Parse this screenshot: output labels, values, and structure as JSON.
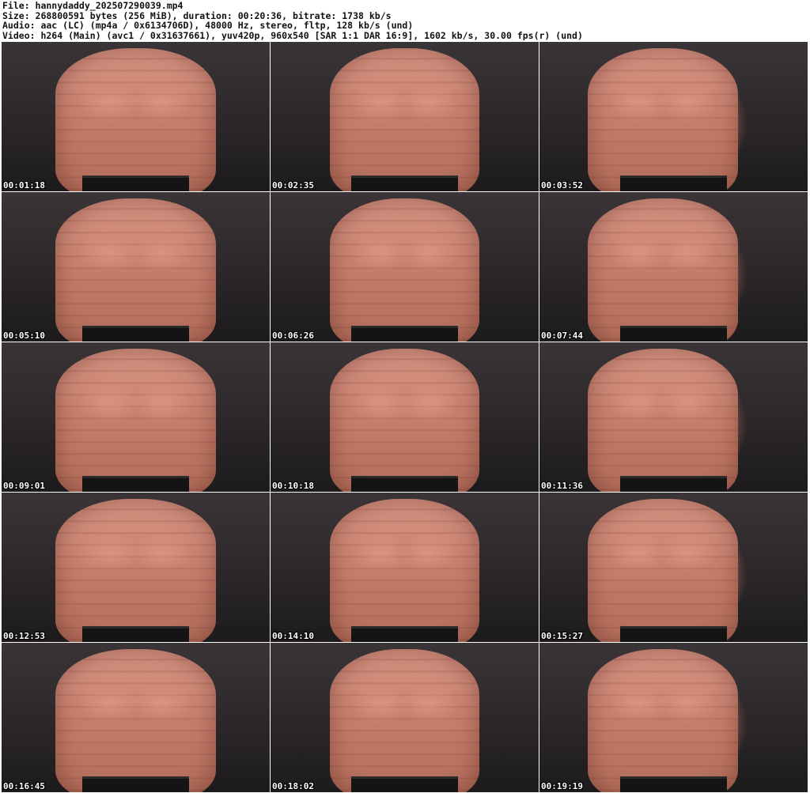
{
  "header": {
    "file": "File: hannydaddy_202507290039.mp4",
    "size": "Size: 268800591 bytes (256 MiB), duration: 00:20:36, bitrate: 1738 kb/s",
    "audio": "Audio: aac (LC) (mp4a / 0x6134706D), 48000 Hz, stereo, fltp, 128 kb/s (und)",
    "video": "Video: h264 (Main) (avc1 / 0x31637661), yuv420p, 960x540 [SAR 1:1 DAR 16:9], 1602 kb/s, 30.00 fps(r) (und)"
  },
  "thumbnails": [
    {
      "timestamp": "00:01:18"
    },
    {
      "timestamp": "00:02:35"
    },
    {
      "timestamp": "00:03:52"
    },
    {
      "timestamp": "00:05:10"
    },
    {
      "timestamp": "00:06:26"
    },
    {
      "timestamp": "00:07:44"
    },
    {
      "timestamp": "00:09:01"
    },
    {
      "timestamp": "00:10:18"
    },
    {
      "timestamp": "00:11:36"
    },
    {
      "timestamp": "00:12:53"
    },
    {
      "timestamp": "00:14:10"
    },
    {
      "timestamp": "00:15:27"
    },
    {
      "timestamp": "00:16:45"
    },
    {
      "timestamp": "00:18:02"
    },
    {
      "timestamp": "00:19:19"
    }
  ]
}
